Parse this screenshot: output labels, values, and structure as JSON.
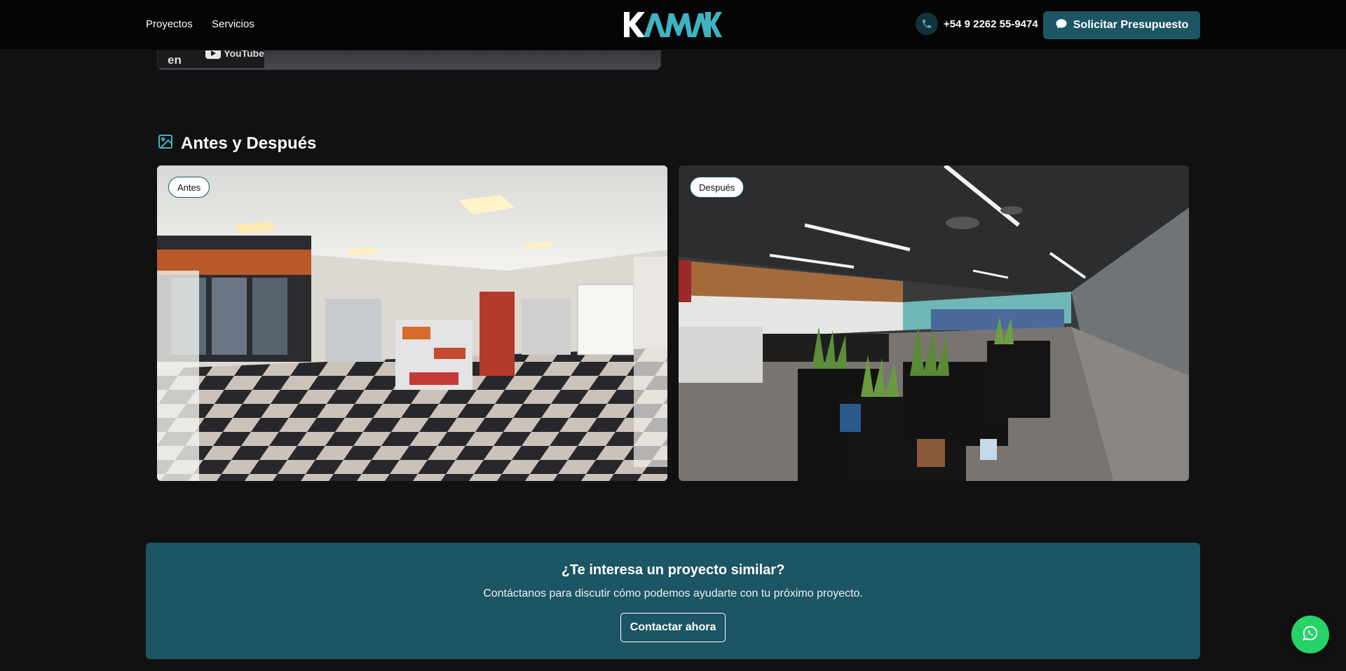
{
  "header": {
    "nav": [
      {
        "label": "Proyectos"
      },
      {
        "label": "Servicios"
      }
    ],
    "logo_text": "KAMAK",
    "phone": "+54 9 2262 55-9474",
    "quote_button": "Solicitar Presupuesto",
    "icons": {
      "phone": "phone-icon",
      "quote": "chat-bubble-icon"
    }
  },
  "video": {
    "watch_on": "Ver en",
    "platform": "YouTube"
  },
  "gallery": {
    "title": "Antes y Después",
    "icon": "image-icon",
    "before_label": "Antes",
    "after_label": "Después"
  },
  "cta": {
    "title": "¿Te interesa un proyecto similar?",
    "text": "Contáctanos para discutir cómo podemos ayudarte con tu próximo proyecto.",
    "button": "Contactar ahora"
  },
  "colors": {
    "accent": "#1c5563",
    "background": "#111111",
    "whatsapp": "#25d366"
  },
  "floating": {
    "icon": "whatsapp-icon"
  }
}
